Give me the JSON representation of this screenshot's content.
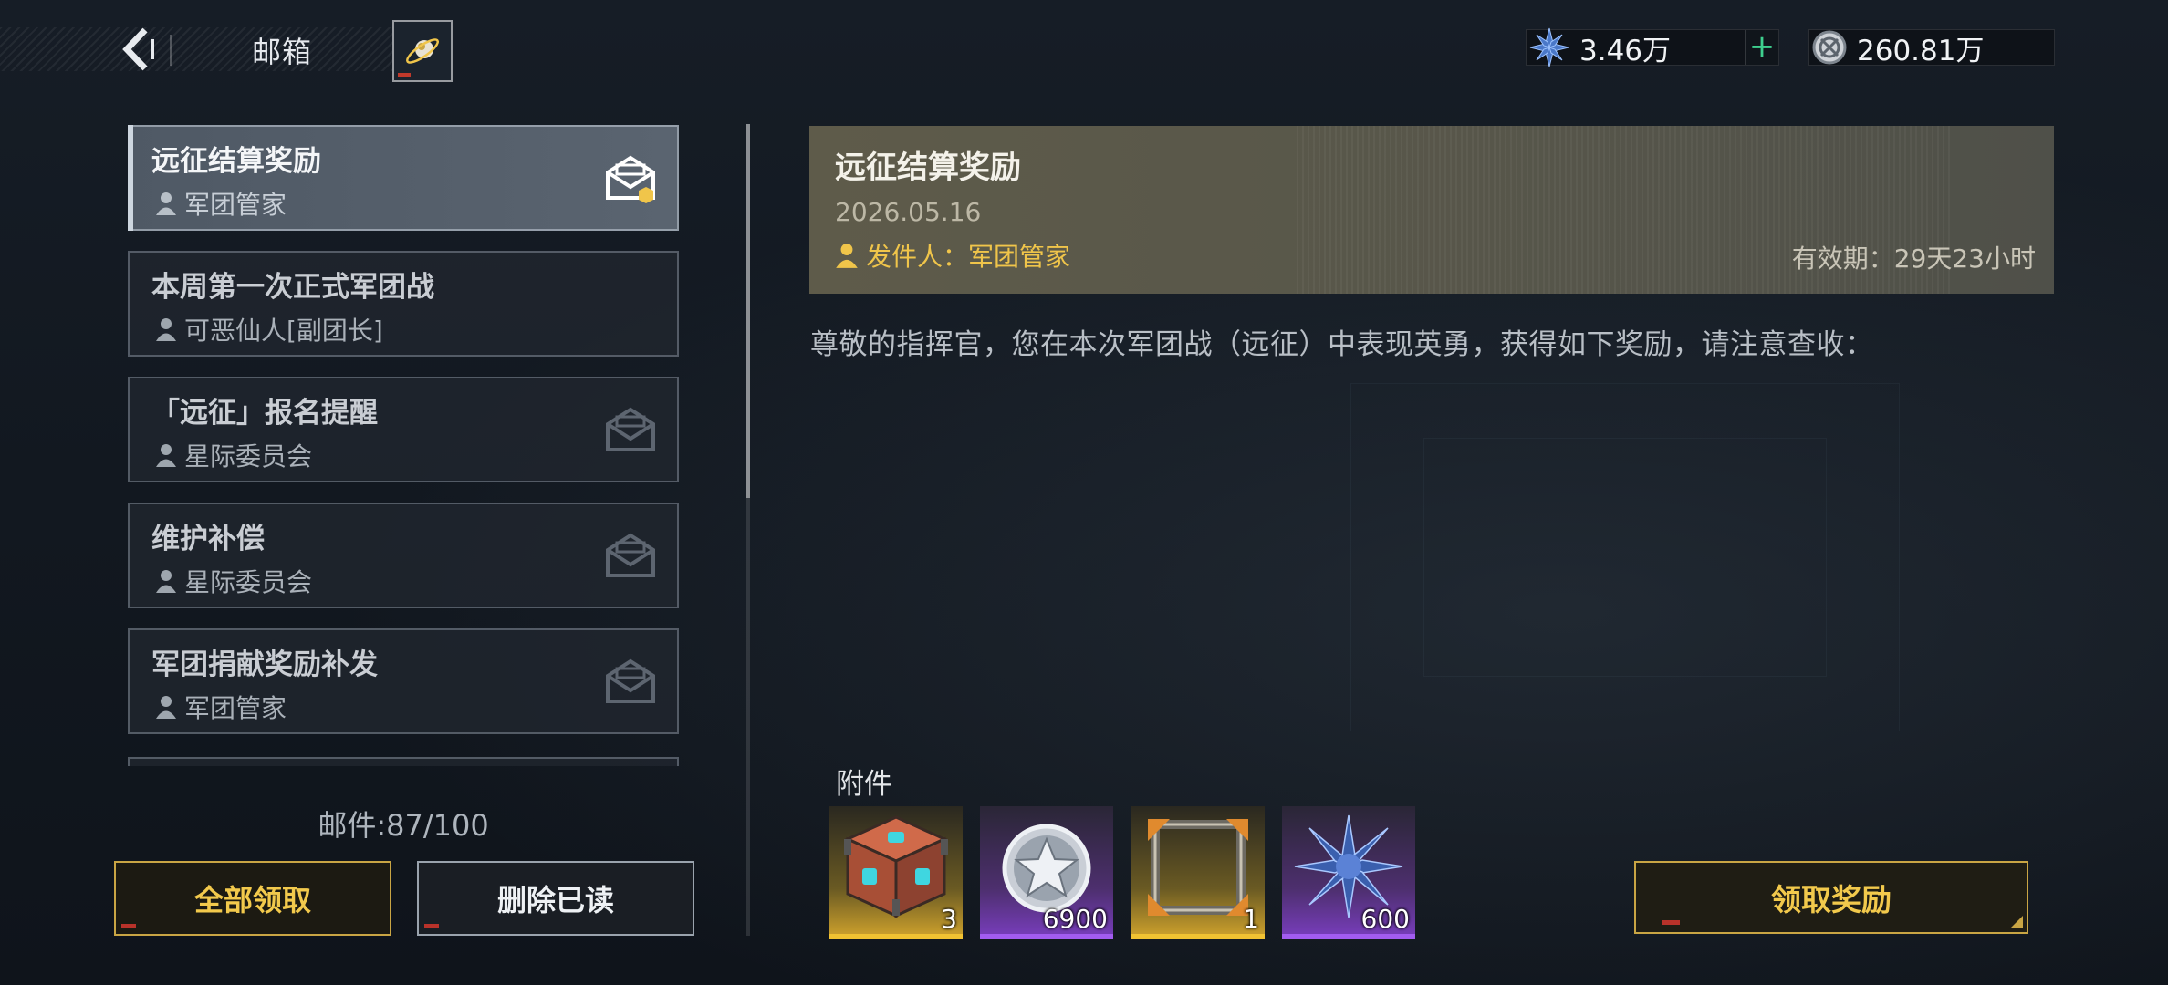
{
  "header": {
    "title": "邮箱",
    "currencies": [
      {
        "icon": "blue-crystal-icon",
        "value": "3.46万",
        "has_plus": true
      },
      {
        "icon": "silver-coin-icon",
        "value": "260.81万",
        "has_plus": false
      }
    ]
  },
  "mail_list": {
    "items": [
      {
        "title": "远征结算奖励",
        "sender": "军团管家",
        "selected": true,
        "has_attachment": true
      },
      {
        "title": "本周第一次正式军团战",
        "sender": "可恶仙人[副团长]",
        "selected": false,
        "has_attachment": false
      },
      {
        "title": "「远征」报名提醒",
        "sender": "星际委员会",
        "selected": false,
        "has_attachment": false
      },
      {
        "title": "维护补偿",
        "sender": "星际委员会",
        "selected": false,
        "has_attachment": false
      },
      {
        "title": "军团捐献奖励补发",
        "sender": "军团管家",
        "selected": false,
        "has_attachment": false
      }
    ],
    "count_label": "邮件:87/100",
    "claim_all_label": "全部领取",
    "delete_read_label": "删除已读"
  },
  "detail": {
    "title": "远征结算奖励",
    "date": "2026.05.16",
    "sender_label": "发件人：军团管家",
    "expiry_label": "有效期：29天23小时",
    "body": "尊敬的指挥官，您在本次军团战（远征）中表现英勇，获得如下奖励，请注意查收：",
    "attachments_label": "附件",
    "attachments": [
      {
        "icon": "supply-crate-icon",
        "rarity": "gold",
        "quantity": "3"
      },
      {
        "icon": "star-medal-coin-icon",
        "rarity": "purple",
        "quantity": "6900"
      },
      {
        "icon": "avatar-frame-icon",
        "rarity": "gold",
        "quantity": "1"
      },
      {
        "icon": "blue-crystal-icon",
        "rarity": "purple",
        "quantity": "600"
      }
    ],
    "claim_label": "领取奖励"
  },
  "colors": {
    "accent_gold": "#f2c94c",
    "sender_yellow": "#f0c54a",
    "plus_green": "#3ecf8e",
    "purple_rarity": "#a25cf0",
    "gold_rarity": "#f1c232"
  }
}
